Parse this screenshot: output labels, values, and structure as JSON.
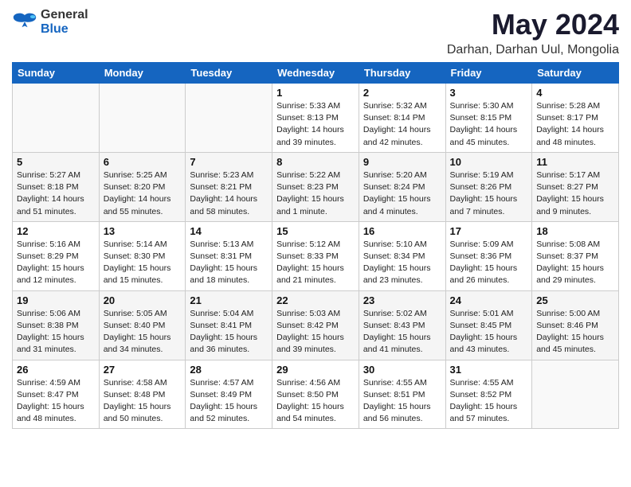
{
  "logo": {
    "general": "General",
    "blue": "Blue"
  },
  "title": "May 2024",
  "subtitle": "Darhan, Darhan Uul, Mongolia",
  "weekdays": [
    "Sunday",
    "Monday",
    "Tuesday",
    "Wednesday",
    "Thursday",
    "Friday",
    "Saturday"
  ],
  "weeks": [
    [
      {
        "day": "",
        "detail": ""
      },
      {
        "day": "",
        "detail": ""
      },
      {
        "day": "",
        "detail": ""
      },
      {
        "day": "1",
        "detail": "Sunrise: 5:33 AM\nSunset: 8:13 PM\nDaylight: 14 hours\nand 39 minutes."
      },
      {
        "day": "2",
        "detail": "Sunrise: 5:32 AM\nSunset: 8:14 PM\nDaylight: 14 hours\nand 42 minutes."
      },
      {
        "day": "3",
        "detail": "Sunrise: 5:30 AM\nSunset: 8:15 PM\nDaylight: 14 hours\nand 45 minutes."
      },
      {
        "day": "4",
        "detail": "Sunrise: 5:28 AM\nSunset: 8:17 PM\nDaylight: 14 hours\nand 48 minutes."
      }
    ],
    [
      {
        "day": "5",
        "detail": "Sunrise: 5:27 AM\nSunset: 8:18 PM\nDaylight: 14 hours\nand 51 minutes."
      },
      {
        "day": "6",
        "detail": "Sunrise: 5:25 AM\nSunset: 8:20 PM\nDaylight: 14 hours\nand 55 minutes."
      },
      {
        "day": "7",
        "detail": "Sunrise: 5:23 AM\nSunset: 8:21 PM\nDaylight: 14 hours\nand 58 minutes."
      },
      {
        "day": "8",
        "detail": "Sunrise: 5:22 AM\nSunset: 8:23 PM\nDaylight: 15 hours\nand 1 minute."
      },
      {
        "day": "9",
        "detail": "Sunrise: 5:20 AM\nSunset: 8:24 PM\nDaylight: 15 hours\nand 4 minutes."
      },
      {
        "day": "10",
        "detail": "Sunrise: 5:19 AM\nSunset: 8:26 PM\nDaylight: 15 hours\nand 7 minutes."
      },
      {
        "day": "11",
        "detail": "Sunrise: 5:17 AM\nSunset: 8:27 PM\nDaylight: 15 hours\nand 9 minutes."
      }
    ],
    [
      {
        "day": "12",
        "detail": "Sunrise: 5:16 AM\nSunset: 8:29 PM\nDaylight: 15 hours\nand 12 minutes."
      },
      {
        "day": "13",
        "detail": "Sunrise: 5:14 AM\nSunset: 8:30 PM\nDaylight: 15 hours\nand 15 minutes."
      },
      {
        "day": "14",
        "detail": "Sunrise: 5:13 AM\nSunset: 8:31 PM\nDaylight: 15 hours\nand 18 minutes."
      },
      {
        "day": "15",
        "detail": "Sunrise: 5:12 AM\nSunset: 8:33 PM\nDaylight: 15 hours\nand 21 minutes."
      },
      {
        "day": "16",
        "detail": "Sunrise: 5:10 AM\nSunset: 8:34 PM\nDaylight: 15 hours\nand 23 minutes."
      },
      {
        "day": "17",
        "detail": "Sunrise: 5:09 AM\nSunset: 8:36 PM\nDaylight: 15 hours\nand 26 minutes."
      },
      {
        "day": "18",
        "detail": "Sunrise: 5:08 AM\nSunset: 8:37 PM\nDaylight: 15 hours\nand 29 minutes."
      }
    ],
    [
      {
        "day": "19",
        "detail": "Sunrise: 5:06 AM\nSunset: 8:38 PM\nDaylight: 15 hours\nand 31 minutes."
      },
      {
        "day": "20",
        "detail": "Sunrise: 5:05 AM\nSunset: 8:40 PM\nDaylight: 15 hours\nand 34 minutes."
      },
      {
        "day": "21",
        "detail": "Sunrise: 5:04 AM\nSunset: 8:41 PM\nDaylight: 15 hours\nand 36 minutes."
      },
      {
        "day": "22",
        "detail": "Sunrise: 5:03 AM\nSunset: 8:42 PM\nDaylight: 15 hours\nand 39 minutes."
      },
      {
        "day": "23",
        "detail": "Sunrise: 5:02 AM\nSunset: 8:43 PM\nDaylight: 15 hours\nand 41 minutes."
      },
      {
        "day": "24",
        "detail": "Sunrise: 5:01 AM\nSunset: 8:45 PM\nDaylight: 15 hours\nand 43 minutes."
      },
      {
        "day": "25",
        "detail": "Sunrise: 5:00 AM\nSunset: 8:46 PM\nDaylight: 15 hours\nand 45 minutes."
      }
    ],
    [
      {
        "day": "26",
        "detail": "Sunrise: 4:59 AM\nSunset: 8:47 PM\nDaylight: 15 hours\nand 48 minutes."
      },
      {
        "day": "27",
        "detail": "Sunrise: 4:58 AM\nSunset: 8:48 PM\nDaylight: 15 hours\nand 50 minutes."
      },
      {
        "day": "28",
        "detail": "Sunrise: 4:57 AM\nSunset: 8:49 PM\nDaylight: 15 hours\nand 52 minutes."
      },
      {
        "day": "29",
        "detail": "Sunrise: 4:56 AM\nSunset: 8:50 PM\nDaylight: 15 hours\nand 54 minutes."
      },
      {
        "day": "30",
        "detail": "Sunrise: 4:55 AM\nSunset: 8:51 PM\nDaylight: 15 hours\nand 56 minutes."
      },
      {
        "day": "31",
        "detail": "Sunrise: 4:55 AM\nSunset: 8:52 PM\nDaylight: 15 hours\nand 57 minutes."
      },
      {
        "day": "",
        "detail": ""
      }
    ]
  ]
}
